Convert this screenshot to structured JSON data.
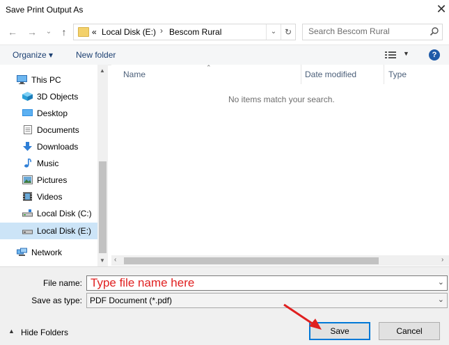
{
  "window": {
    "title": "Save Print Output As"
  },
  "address": {
    "prefix": "«",
    "crumbs": [
      "Local Disk (E:)",
      "Bescom Rural"
    ],
    "separator": "›"
  },
  "search": {
    "placeholder": "Search Bescom Rural"
  },
  "toolbar": {
    "organize": "Organize ▾",
    "new_folder": "New folder"
  },
  "nav": {
    "items": [
      {
        "label": "This PC",
        "icon": "this-pc-icon"
      },
      {
        "label": "3D Objects",
        "icon": "3d-objects-icon"
      },
      {
        "label": "Desktop",
        "icon": "desktop-icon"
      },
      {
        "label": "Documents",
        "icon": "documents-icon"
      },
      {
        "label": "Downloads",
        "icon": "downloads-icon"
      },
      {
        "label": "Music",
        "icon": "music-icon"
      },
      {
        "label": "Pictures",
        "icon": "pictures-icon"
      },
      {
        "label": "Videos",
        "icon": "videos-icon"
      },
      {
        "label": "Local Disk (C:)",
        "icon": "drive-icon"
      },
      {
        "label": "Local Disk (E:)",
        "icon": "drive-icon",
        "selected": true
      },
      {
        "label": "Network",
        "icon": "network-icon"
      }
    ]
  },
  "columns": {
    "name": "Name",
    "date_modified": "Date modified",
    "type": "Type"
  },
  "content": {
    "empty_message": "No items match your search."
  },
  "form": {
    "file_name_label": "File name:",
    "file_name_placeholder": "Type file name here",
    "save_as_type_label": "Save as type:",
    "save_as_type_value": "PDF Document (*.pdf)"
  },
  "footer": {
    "hide_folders": "Hide Folders",
    "save": "Save",
    "cancel": "Cancel"
  },
  "colors": {
    "accent": "#0078d7",
    "selected_bg": "#cce4f7",
    "annotation": "#e02020"
  }
}
